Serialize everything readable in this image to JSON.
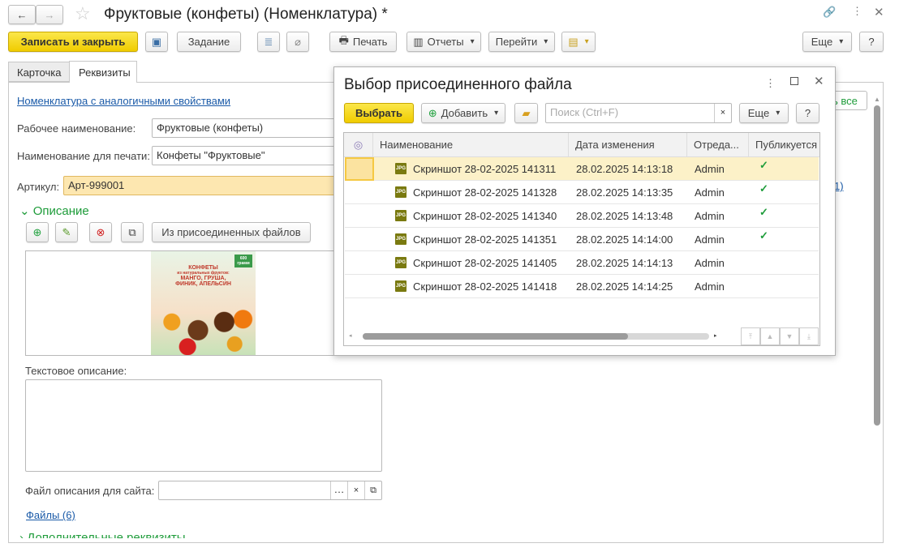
{
  "window": {
    "title": "Фруктовые (конфеты) (Номенклатура) *"
  },
  "toolbar": {
    "save_close": "Записать и закрыть",
    "task": "Задание",
    "print": "Печать",
    "reports": "Отчеты",
    "goto": "Перейти",
    "more": "Еще",
    "help": "?"
  },
  "tabs": [
    {
      "label": "Карточка"
    },
    {
      "label": "Реквизиты"
    }
  ],
  "form": {
    "similar_link": "Номенклатура с аналогичными свойствами",
    "work_name_label": "Рабочее наименование:",
    "work_name": "Фруктовые (конфеты)",
    "print_name_label": "Наименование для печати:",
    "print_name": "Конфеты \"Фруктовые\"",
    "article_label": "Артикул:",
    "article": "Арт-999001",
    "description_header": "Описание",
    "from_files_btn": "Из присоединенных файлов",
    "image_text": [
      "КОНФЕТЫ",
      "из натуральных фруктов:",
      "МАНГО, ГРУША,",
      "ФИНИК, АПЕЛЬСИН",
      "600 грамм"
    ],
    "text_desc_label": "Текстовое описание:",
    "text_desc": "",
    "site_file_label": "Файл описания для сайта:",
    "site_file": "",
    "files_link": "Файлы (6)",
    "extra_header": "Дополнительные реквизиты",
    "hidden_btn_fragment": "ь все",
    "hidden_link_fragment": "1)"
  },
  "dialog": {
    "title": "Выбор присоединенного файла",
    "select": "Выбрать",
    "add": "Добавить",
    "search_placeholder": "Поиск (Ctrl+F)",
    "search_value": "",
    "more": "Еще",
    "help": "?",
    "columns": [
      "Наименование",
      "Дата изменения",
      "Отреда...",
      "Публикуется"
    ],
    "rows": [
      {
        "name": "Скриншот 28-02-2025 141311",
        "date": "28.02.2025 14:13:18",
        "editor": "Admin",
        "published": true,
        "selected": true
      },
      {
        "name": "Скриншот 28-02-2025 141328",
        "date": "28.02.2025 14:13:35",
        "editor": "Admin",
        "published": true
      },
      {
        "name": "Скриншот 28-02-2025 141340",
        "date": "28.02.2025 14:13:48",
        "editor": "Admin",
        "published": true
      },
      {
        "name": "Скриншот 28-02-2025 141351",
        "date": "28.02.2025 14:14:00",
        "editor": "Admin",
        "published": true
      },
      {
        "name": "Скриншот 28-02-2025 141405",
        "date": "28.02.2025 14:14:13",
        "editor": "Admin",
        "published": false
      },
      {
        "name": "Скриншот 28-02-2025 141418",
        "date": "28.02.2025 14:14:25",
        "editor": "Admin",
        "published": false
      }
    ]
  }
}
